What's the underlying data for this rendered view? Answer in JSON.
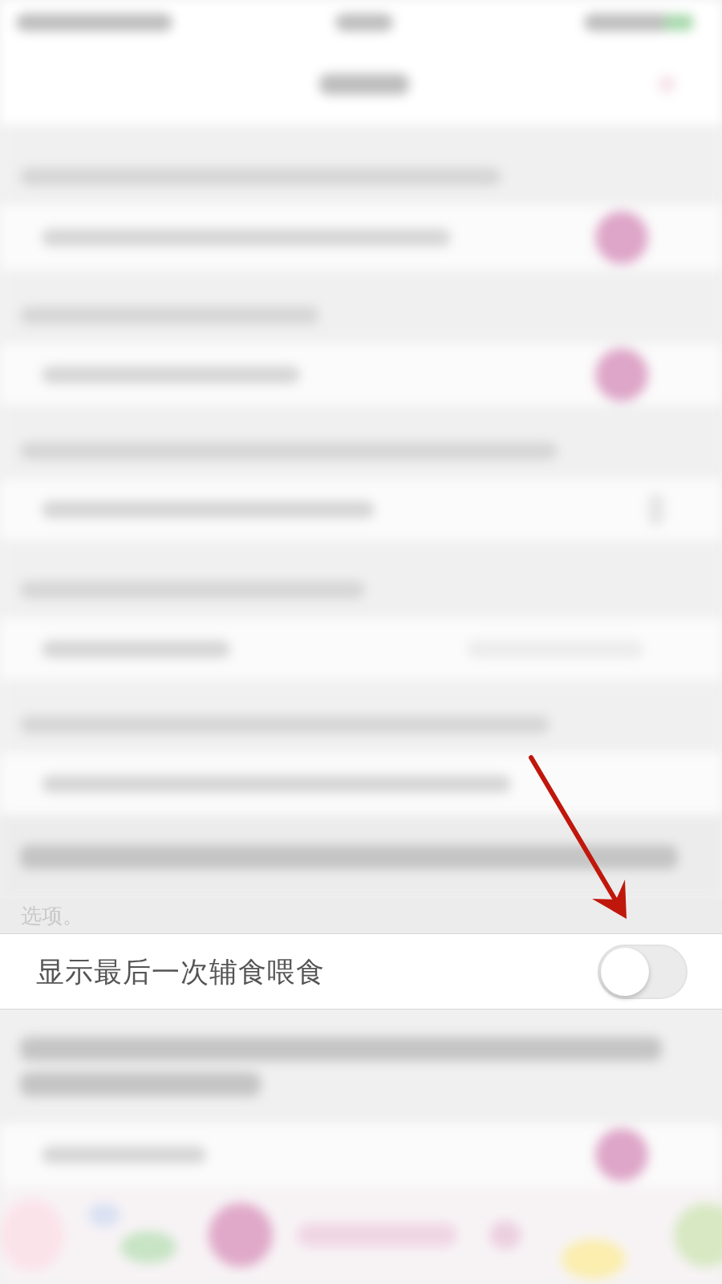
{
  "footer_note": {
    "text": "选项。"
  },
  "setting_row": {
    "label": "显示最后一次辅食喂食",
    "on": false
  }
}
